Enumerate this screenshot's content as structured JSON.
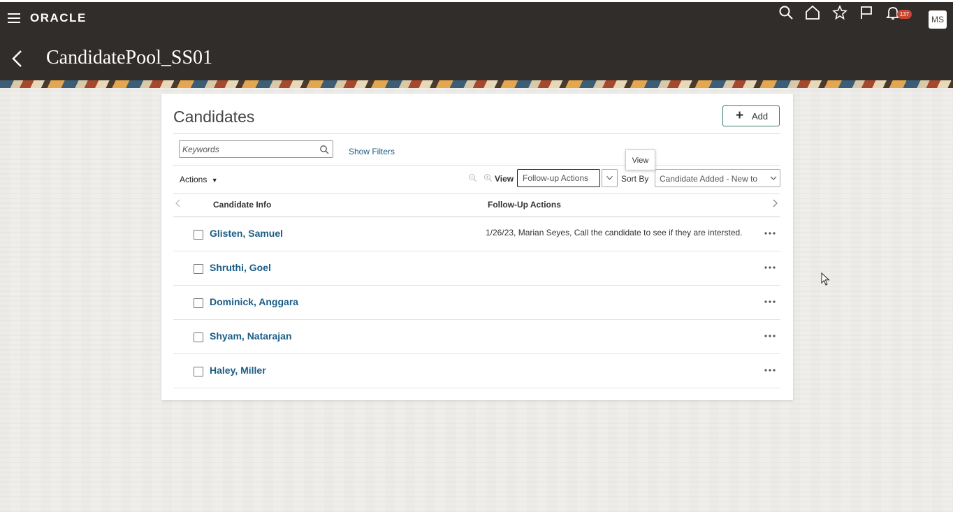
{
  "header": {
    "brand": "ORACLE",
    "page_title": "CandidatePool_SS01",
    "notification_count": "137",
    "avatar_initials": "MS"
  },
  "card": {
    "title": "Candidates",
    "add_label": "Add",
    "search_placeholder": "Keywords",
    "show_filters": "Show Filters",
    "actions_label": "Actions",
    "view_label": "View",
    "view_value": "Follow-up Actions",
    "sort_label": "Sort By",
    "sort_value": "Candidate Added - New to",
    "tooltip": "View",
    "columns": [
      "Candidate Info",
      "Follow-Up Actions"
    ],
    "rows": [
      {
        "name": "Glisten, Samuel",
        "followup": "1/26/23, Marian Seyes, Call the candidate to see if they are intersted."
      },
      {
        "name": "Shruthi, Goel",
        "followup": ""
      },
      {
        "name": "Dominick, Anggara",
        "followup": ""
      },
      {
        "name": "Shyam, Natarajan",
        "followup": ""
      },
      {
        "name": "Haley, Miller",
        "followup": ""
      }
    ]
  },
  "colors": {
    "header_bg": "#312d2a",
    "link": "#1b5e87",
    "badge": "#c74634",
    "add_border": "#3a7a6e"
  }
}
